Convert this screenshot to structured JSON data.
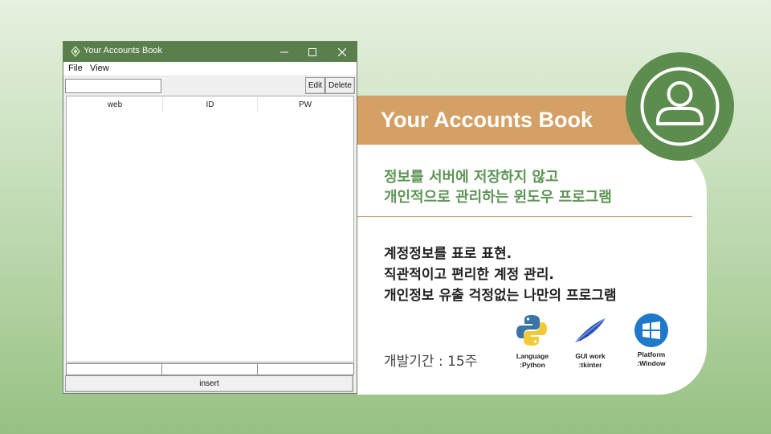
{
  "window": {
    "title": "Your Accounts Book",
    "menu": [
      "File",
      "View"
    ],
    "search_value": "",
    "edit_label": "Edit",
    "delete_label": "Delete",
    "columns": [
      "web",
      "ID",
      "PW"
    ],
    "rows": [],
    "input_values": [
      "",
      "",
      ""
    ],
    "insert_label": "insert"
  },
  "panel": {
    "title": "Your Accounts Book",
    "subtitle_lines": [
      "정보를 서버에 저장하지 않고",
      "개인적으로 관리하는 윈도우 프로그램"
    ],
    "features": [
      "계정정보를 표로 표현.",
      "직관적이고 편리한 계정 관리.",
      "개인정보 유출 걱정없는 나만의 프로그램"
    ],
    "period": "개발기간 : 15주",
    "logos": [
      {
        "icon": "python-logo",
        "line1": "Language",
        "line2": ":Python"
      },
      {
        "icon": "feather-logo",
        "line1": "GUI work",
        "line2": ":tkinter"
      },
      {
        "icon": "windows-logo",
        "line1": "Platform",
        "line2": ":Window"
      }
    ]
  },
  "colors": {
    "green": "#5c8c4e",
    "title_bar": "#5a7f4c",
    "orange": "#d4a065",
    "subtitle_green": "#5e9556"
  }
}
